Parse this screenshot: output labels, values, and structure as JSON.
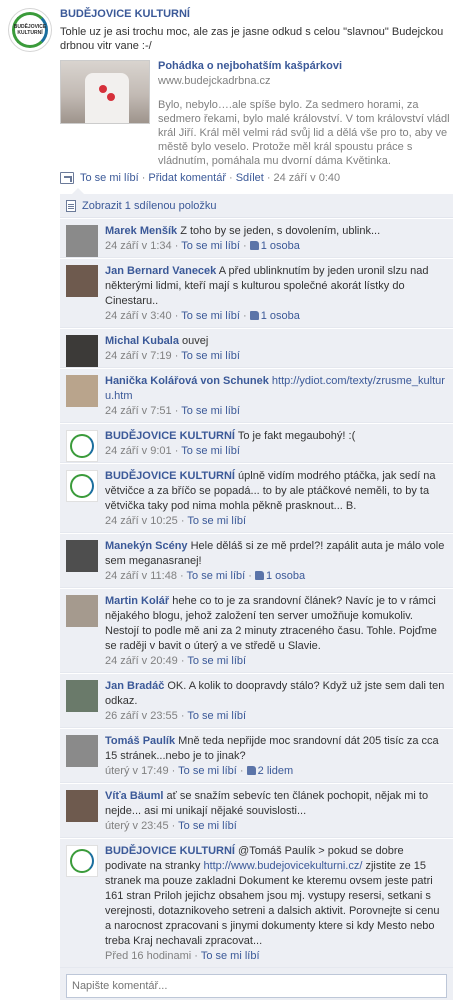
{
  "post": {
    "author": "BUDĚJOVICE KULTURNÍ",
    "avatar_text": "BUDĚJOVICE KULTURNÍ",
    "text": "Tohle uz je asi trochu moc, ale zas je jasne odkud s celou \"slavnou\" Budejckou drbnou vitr vane :-/",
    "link": {
      "title": "Pohádka o nejbohatším kašpárkovi",
      "url": "www.budejckadrbna.cz",
      "description": "Bylo, nebylo….ale spíše bylo. Za sedmero horami, za sedmero řekami, bylo malé království. V tom království vládl král Jiří. Král měl velmi rád svůj lid a dělá vše pro to, aby ve městě bylo veselo. Protože měl král spoustu práce s vládnutím, pomáhala mu dvorní dáma Květinka."
    },
    "actions": {
      "like": "To se mi líbí",
      "comment": "Přidat komentář",
      "share": "Sdílet",
      "time": "24 září v 0:40"
    }
  },
  "comments_section": {
    "shared_label": "Zobrazit 1 sdílenou položku",
    "comments": [
      {
        "author": "Marek Menšík",
        "text": "Z toho by se jeden, s dovolením, ublink...",
        "time": "24 září v 1:34",
        "like": "To se mi líbí",
        "likes": "1 osoba",
        "avatar": "person"
      },
      {
        "author": "Jan Bernard Vanecek",
        "text": "A před ublinknutím by jeden uronil slzu nad některými lidmi, kteří mají s kulturou společné akorát lístky do Cinestaru..",
        "time": "24 září v 3:40",
        "like": "To se mi líbí",
        "likes": "1 osoba",
        "avatar": "person"
      },
      {
        "author": "Michal Kubala",
        "text": "ouvej",
        "time": "24 září v 7:19",
        "like": "To se mi líbí",
        "likes": "",
        "avatar": "person"
      },
      {
        "author": "Hanička Kolářová von Schunek",
        "text": "",
        "link": "http://ydiot.com/texty/zrusme_kulturu.htm",
        "time": "24 září v 7:51",
        "like": "To se mi líbí",
        "likes": "",
        "avatar": "person"
      },
      {
        "author": "BUDĚJOVICE KULTURNÍ",
        "text": "To je fakt megaubohý! :(",
        "time": "24 září v 9:01",
        "like": "To se mi líbí",
        "likes": "",
        "avatar": "page"
      },
      {
        "author": "BUDĚJOVICE KULTURNÍ",
        "text": "úplně vidím modrého ptáčka, jak sedí na větvičce a za bříčo se popadá... to by ale ptáčkové neměli, to by ta větvička taky pod nima mohla pěkně prasknout... B.",
        "time": "24 září v 10:25",
        "like": "To se mi líbí",
        "likes": "",
        "avatar": "page"
      },
      {
        "author": "Manekýn Scény",
        "text": "Hele děláš si ze mě prdel?! zapálit auta je málo vole sem meganasranej!",
        "time": "24 září v 11:48",
        "like": "To se mi líbí",
        "likes": "1 osoba",
        "avatar": "person"
      },
      {
        "author": "Martin Kolář",
        "text": "hehe co to je za srandovní článek? Navíc je to v rámci nějakého blogu, jehož založení ten server umožňuje komukoliv. Nestojí to podle mě ani za 2 minuty ztraceného času. Tohle. Pojďme se raději v bavit o úterý a ve středě u Slavie.",
        "time": "24 září v 20:49",
        "like": "To se mi líbí",
        "likes": "",
        "avatar": "person"
      },
      {
        "author": "Jan Bradáč",
        "text": "OK. A kolik to doopravdy stálo? Když už jste sem dali ten odkaz.",
        "time": "26 září v 23:55",
        "like": "To se mi líbí",
        "likes": "",
        "avatar": "person"
      },
      {
        "author": "Tomáš Paulík",
        "text": "Mně teda nepřijde moc srandovní dát 205 tisíc za cca 15 stránek...nebo je to jinak?",
        "time": "úterý v 17:49",
        "like": "To se mi líbí",
        "likes": "2 lidem",
        "avatar": "person"
      },
      {
        "author": "Víťa Bäuml",
        "text": "ať se snažím sebevíc ten článek pochopit, nějak mi to nejde... asi mi unikají nějaké souvislosti...",
        "time": "úterý v 23:45",
        "like": "To se mi líbí",
        "likes": "",
        "avatar": "person"
      },
      {
        "author": "BUDĚJOVICE KULTURNÍ",
        "text_before": "@Tomáš Paulík > pokud se dobre podivate na stranky",
        "link": "http://www.budejovicekulturni.cz/",
        "text_after": "zjistite ze 15 stranek ma pouze zakladni Dokument ke kteremu ovsem jeste patri 161 stran Priloh jejichz obsahem jsou mj. vystupy resersi, setkani s verejnosti, dotaznikoveho setreni a dalsich aktivit. Porovnejte si cenu a narocnost zpracovani s jinymi dokumenty ktere si kdy Mesto nebo treba Kraj nechavali zpracovat...",
        "time": "Před 16 hodinami",
        "like": "To se mi líbí",
        "likes": "",
        "avatar": "page"
      }
    ],
    "write_placeholder": "Napište komentář..."
  },
  "colors": {
    "link": "#3b5998",
    "meta": "#808080",
    "comment_bg": "#edeff4",
    "page_green": "#3a9b3a"
  }
}
